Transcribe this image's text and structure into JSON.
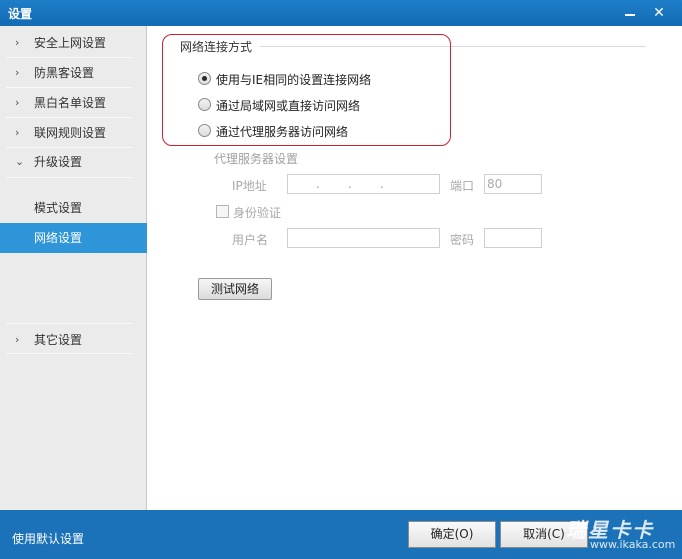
{
  "window": {
    "title": "设置"
  },
  "sidebar": {
    "items": [
      {
        "label": "安全上网设置",
        "arrow": "›"
      },
      {
        "label": "防黑客设置",
        "arrow": "›"
      },
      {
        "label": "黑白名单设置",
        "arrow": "›"
      },
      {
        "label": "联网规则设置",
        "arrow": "›"
      },
      {
        "label": "升级设置",
        "arrow": "⌄"
      }
    ],
    "subitems": [
      {
        "label": "模式设置"
      },
      {
        "label": "网络设置"
      }
    ],
    "other": {
      "label": "其它设置",
      "arrow": "›"
    }
  },
  "network": {
    "group_title": "网络连接方式",
    "options": [
      {
        "label": "使用与IE相同的设置连接网络"
      },
      {
        "label": "通过局域网或直接访问网络"
      },
      {
        "label": "通过代理服务器访问网络"
      }
    ],
    "selected": 0,
    "proxy": {
      "title": "代理服务器设置",
      "ip_label": "IP地址",
      "ip_dots": [
        ".",
        ".",
        "."
      ],
      "port_label": "端口",
      "port_value": "80",
      "auth_label": "身份验证",
      "username_label": "用户名",
      "password_label": "密码"
    },
    "test_button": "测试网络"
  },
  "footer": {
    "default_link": "使用默认设置",
    "ok_button": "确定(O)",
    "cancel_button": "取消(C)",
    "watermark_text": "瑞星卡卡",
    "watermark_url": "www.ikaka.com"
  },
  "colors": {
    "titlebar": "#1b72b8",
    "accent": "#2e95d8",
    "highlight": "#d01f2f"
  },
  "icons": {
    "minimize": "minimize-icon",
    "close": "close-icon",
    "expand": "chevron-right-icon",
    "collapse": "chevron-down-icon"
  }
}
